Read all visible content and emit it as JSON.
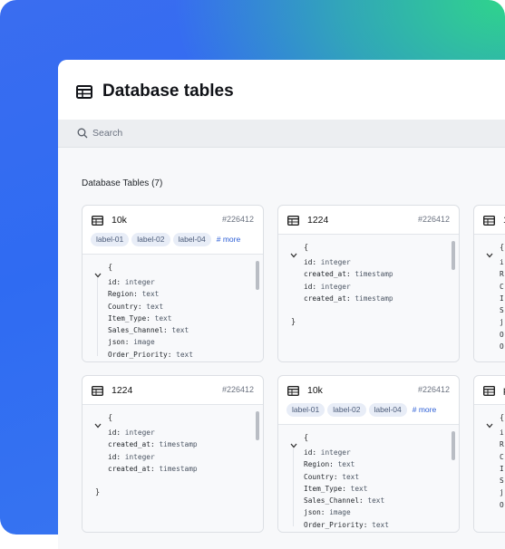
{
  "header": {
    "title": "Database tables"
  },
  "search": {
    "placeholder": "Search"
  },
  "section": {
    "title": "Database Tables (7)"
  },
  "cards": [
    {
      "name": "10k",
      "id": "#226412",
      "labels": [
        "label-01",
        "label-02",
        "label-04"
      ],
      "more": "# more",
      "fields": [
        {
          "k": "id:",
          "v": "integer"
        },
        {
          "k": "Region:",
          "v": "text"
        },
        {
          "k": "Country:",
          "v": "text"
        },
        {
          "k": "Item_Type:",
          "v": "text"
        },
        {
          "k": "Sales_Channel:",
          "v": "text"
        },
        {
          "k": "json:",
          "v": "image"
        },
        {
          "k": "Order_Priority:",
          "v": "text"
        }
      ]
    },
    {
      "name": "1224",
      "id": "#226412",
      "fields": [
        {
          "k": "id:",
          "v": "integer"
        },
        {
          "k": "created_at:",
          "v": "timestamp"
        },
        {
          "k": "id:",
          "v": "integer"
        },
        {
          "k": "created_at:",
          "v": "timestamp"
        }
      ]
    },
    {
      "name": "1224",
      "id": "#226412",
      "fields": [
        {
          "k": "id:",
          "v": "integer"
        },
        {
          "k": "created_at:",
          "v": "timestamp"
        },
        {
          "k": "id:",
          "v": "integer"
        },
        {
          "k": "created_at:",
          "v": "timestamp"
        }
      ]
    },
    {
      "name": "10k",
      "id": "#226412",
      "labels": [
        "label-01",
        "label-02",
        "label-04"
      ],
      "more": "# more",
      "fields": [
        {
          "k": "id:",
          "v": "integer"
        },
        {
          "k": "Region:",
          "v": "text"
        },
        {
          "k": "Country:",
          "v": "text"
        },
        {
          "k": "Item_Type:",
          "v": "text"
        },
        {
          "k": "Sales_Channel:",
          "v": "text"
        },
        {
          "k": "json:",
          "v": "image"
        },
        {
          "k": "Order_Priority:",
          "v": "text"
        }
      ]
    }
  ],
  "partial_cards": [
    {
      "name": "1",
      "initials": [
        "i",
        "R",
        "C",
        "I",
        "S",
        "j",
        "O",
        "O"
      ]
    },
    {
      "name": "p",
      "initials": [
        "i",
        "R",
        "C",
        "I",
        "S",
        "j",
        "O"
      ]
    }
  ],
  "glyphs": {
    "brace_open": "{",
    "brace_close": "}"
  },
  "colors": {
    "accent": "#2d5fd6",
    "gradient_blue": "#2f6bf2",
    "gradient_green": "#2fd48c"
  }
}
